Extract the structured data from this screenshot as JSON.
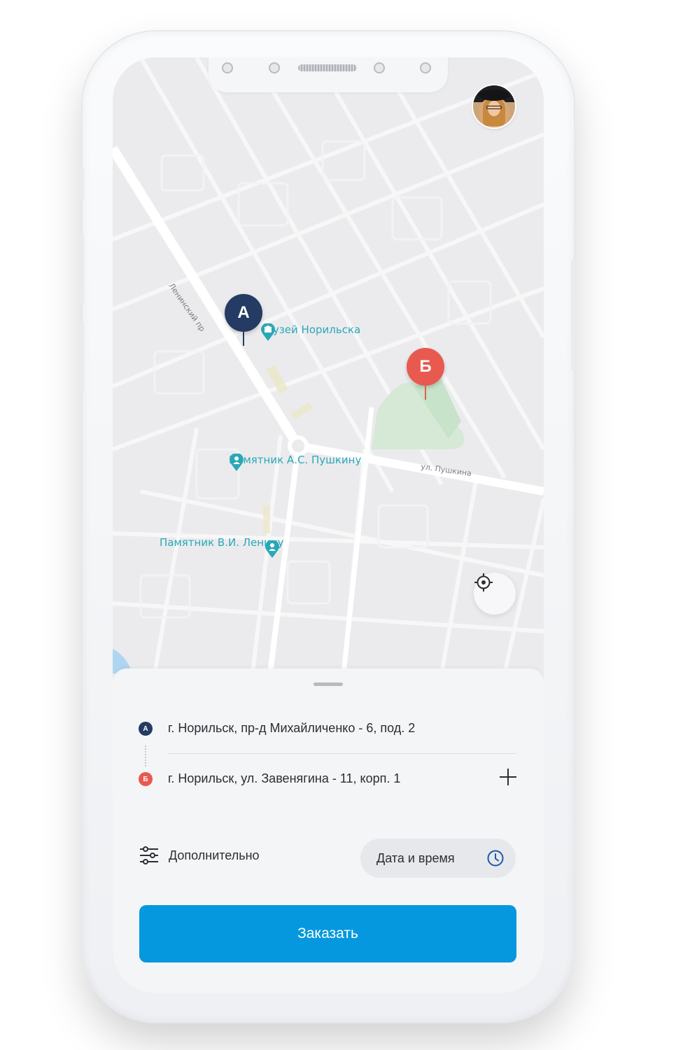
{
  "map": {
    "poi_museum": "Музей Норильска",
    "poi_pushkin_monument": "Памятник А.С. Пушкину",
    "poi_lenin_monument": "Памятник В.И. Ленину",
    "street_pushkin": "ул. Пушкина",
    "street_leninsky": "Ленинский пр",
    "pin_a_letter": "А",
    "pin_b_letter": "Б",
    "pin_a_color": "#243b63",
    "pin_b_color": "#e85a4f",
    "poi_color": "#2aa8b8"
  },
  "route": {
    "from_marker": "А",
    "from_address": "г. Норильск, пр-д Михайличенко - 6, под. 2",
    "to_marker": "Б",
    "to_address": "г. Норильск, ул. Завенягина - 11, корп. 1"
  },
  "options": {
    "extra_label": "Дополнительно",
    "datetime_label": "Дата и время"
  },
  "actions": {
    "order_label": "Заказать",
    "accent_color": "#0598de"
  },
  "icons": {
    "avatar": "user-avatar",
    "locate": "crosshair-icon",
    "add": "plus-icon",
    "settings": "sliders-icon",
    "clock": "clock-icon"
  }
}
